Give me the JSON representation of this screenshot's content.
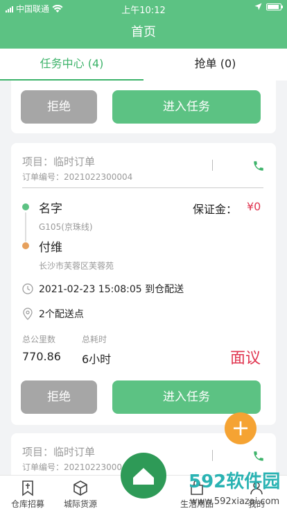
{
  "status_bar": {
    "carrier": "中国联通",
    "time": "上午10:12"
  },
  "header": {
    "title": "首页"
  },
  "tabs": [
    {
      "label": "任务中心 (4)",
      "active": true
    },
    {
      "label": "抢单 (0)",
      "active": false
    }
  ],
  "card_actions": {
    "reject_label": "拒绝",
    "enter_label": "进入任务"
  },
  "order": {
    "project_label": "项目：临时订单",
    "order_no_label": "订单编号：2021022300004",
    "from_name": "名字",
    "from_road": "G105(京珠线)",
    "deposit_label": "保证金：",
    "deposit_value": "¥0",
    "to_name": "付维",
    "to_address": "长沙市芙蓉区芙蓉苑",
    "datetime": "2021-02-23 15:08:05 到仓配送",
    "points": "2个配送点",
    "distance_label": "总公里数",
    "distance_value": "770.86",
    "duration_label": "总耗时",
    "duration_value": "6小时",
    "price": "面议"
  },
  "order_partial": {
    "project_label": "项目：临时订单",
    "order_no_label": "订单编号：20210223000"
  },
  "bottom_nav": {
    "item1": "仓库招募",
    "item2": "城际货源",
    "item4": "生活用品",
    "item5": "我的"
  },
  "watermark": {
    "brand": "592软件园",
    "url": "www.592xiazai.com"
  },
  "colors": {
    "primary": "#5cc283",
    "accent_orange": "#f5a333",
    "price_red": "#e0344f",
    "reject_gray": "#a6a6a6"
  }
}
